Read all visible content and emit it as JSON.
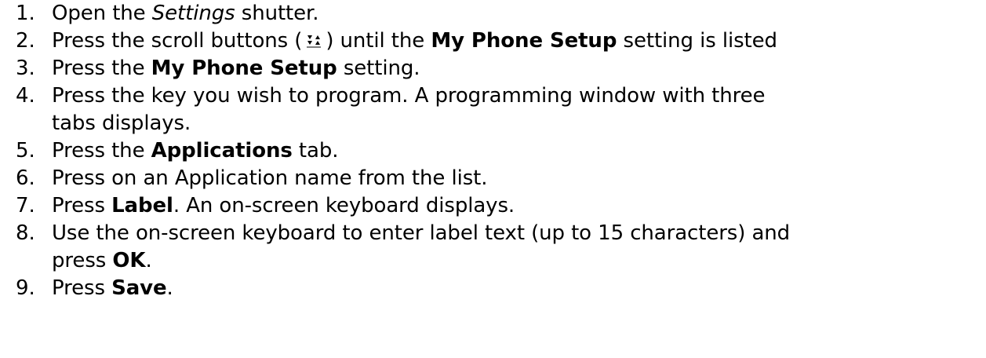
{
  "steps": [
    {
      "num": "1.",
      "parts": [
        "Open the ",
        "Settings",
        " shutter."
      ]
    },
    {
      "num": "2.",
      "parts": [
        "Press the scroll buttons (",
        "scroll-buttons-icon",
        ") until the ",
        "My Phone Setup",
        " setting is listed"
      ]
    },
    {
      "num": "3.",
      "parts": [
        "Press the ",
        "My Phone Setup",
        " setting."
      ]
    },
    {
      "num": "4.",
      "lines": [
        "Press the key you wish to program. A programming window with three",
        "tabs displays."
      ]
    },
    {
      "num": "5.",
      "parts": [
        "Press the ",
        "Applications",
        " tab."
      ]
    },
    {
      "num": "6.",
      "parts": [
        "Press on an Application name from the list."
      ]
    },
    {
      "num": "7.",
      "parts": [
        "Press ",
        "Label",
        ". An on-screen keyboard displays."
      ]
    },
    {
      "num": "8.",
      "lines": [
        "Use the on-screen keyboard to enter label text (up to 15 characters) and",
        "press "
      ],
      "bold": "OK",
      "tail": "."
    },
    {
      "num": "9.",
      "parts": [
        "Press ",
        "Save",
        "."
      ]
    }
  ],
  "icons": {
    "scroll": "scroll-buttons-icon"
  }
}
